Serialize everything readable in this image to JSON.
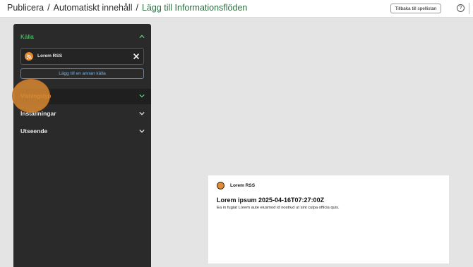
{
  "breadcrumb": {
    "items": [
      "Publicera",
      "Automatiskt innehåll"
    ],
    "separator": "/",
    "current": "Lägg till Informationsflöden"
  },
  "header": {
    "back_label": "Tillbaka till spellistan",
    "help_icon": "help-icon",
    "help_glyph": "?"
  },
  "sidebar": {
    "source_section": {
      "label": "Källa",
      "expanded": true
    },
    "source_item": {
      "name": "Lorem RSS",
      "icon": "rss-icon"
    },
    "add_source_label": "Lägg till en annan källa",
    "sections": [
      {
        "label": "Visningstyp",
        "expanded": false
      },
      {
        "label": "Inställningar",
        "expanded": false
      },
      {
        "label": "Utseende",
        "expanded": false
      }
    ]
  },
  "preview": {
    "source": "Lorem RSS",
    "title": "Lorem ipsum 2025-04-16T07:27:00Z",
    "body": "Ea in fugiat Lorem aute eiusmod id nostrud ut sint culpa officia quis."
  },
  "colors": {
    "accent_green": "#5fd07a",
    "accent_blue": "#3d8fd6",
    "highlight_orange": "#df8c32",
    "sidebar_bg": "#2a2a2a"
  }
}
